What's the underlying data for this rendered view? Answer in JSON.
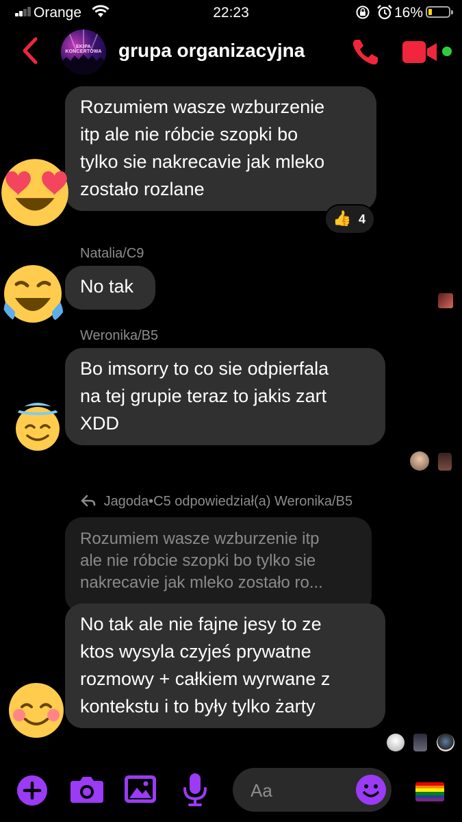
{
  "status_bar": {
    "carrier": "Orange",
    "time": "22:23",
    "battery_percent": "16%",
    "battery_level": 0.16,
    "icons": [
      "signal-icon",
      "wifi-icon",
      "rotation-lock-icon",
      "alarm-icon",
      "battery-icon"
    ]
  },
  "header": {
    "title": "grupa organizacyjna",
    "avatar_text": "EKIPA KONCERTOWA",
    "online": true
  },
  "messages": {
    "m1": {
      "lines": [
        "Rozumiem wasze wzburzenie",
        "itp ale nie róbcie szopki bo",
        "tylko sie nakrecavie jak mleko",
        "zostało rozlane"
      ],
      "sender_emoji": "heart-eyes-emoji",
      "reaction": {
        "icon": "thumbs-up",
        "emoji": "👍",
        "count": "4"
      }
    },
    "m2": {
      "sender": "Natalia/C9",
      "lines": [
        "No tak"
      ],
      "sender_emoji": "tears-of-joy-emoji"
    },
    "m3": {
      "sender": "Weronika/B5",
      "lines": [
        "Bo imsorry to co sie odpierfala",
        "na tej grupie teraz to jakis zart",
        "XDD"
      ],
      "sender_emoji": "halo-smile-emoji"
    },
    "m4": {
      "reply_note": "Jagoda•C5 odpowiedział(a) Weronika/B5",
      "quoted_lines": [
        "Rozumiem wasze wzburzenie itp",
        "ale nie róbcie szopki bo tylko sie",
        "nakrecavie jak mleko zostało ro..."
      ],
      "lines": [
        "No tak ale nie fajne jesy to ze",
        "ktos wysyla czyjeś prywatne",
        "rozmowy + całkiem wyrwane z",
        "kontekstu i to były tylko żarty"
      ],
      "sender_emoji": "blushing-smile-emoji"
    }
  },
  "composer": {
    "placeholder": "Aa",
    "buttons": [
      "plus-icon",
      "camera-icon",
      "gallery-icon",
      "microphone-icon"
    ],
    "emoji_button": "smiley-icon",
    "flag": "rainbow-flag-icon"
  },
  "colors": {
    "accent_red": "#f0263c",
    "accent_purple": "#9b3bf5",
    "bubble": "#303030",
    "quoted_bubble": "#1c1c1c",
    "background": "#000000"
  }
}
